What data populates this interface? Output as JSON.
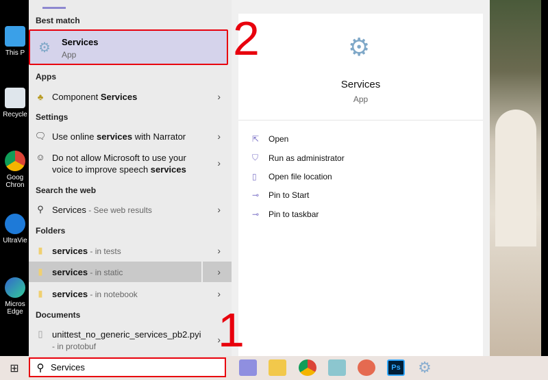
{
  "desktop": {
    "icons": [
      "This P",
      "Recycle",
      "Goog Chron",
      "UltraVie",
      "Micros Edge"
    ]
  },
  "left": {
    "best_match_header": "Best match",
    "best": {
      "title": "Services",
      "subtitle": "App"
    },
    "apps_header": "Apps",
    "apps": [
      {
        "pre": "Component ",
        "bold": "Services",
        "post": ""
      }
    ],
    "settings_header": "Settings",
    "settings": [
      {
        "pre": "Use online ",
        "bold": "services",
        "post": " with Narrator"
      },
      {
        "line1": "Do not allow Microsoft to use your",
        "line2pre": "voice to improve speech ",
        "line2bold": "services"
      }
    ],
    "web_header": "Search the web",
    "web": {
      "term": "Services",
      "suffix": " - See web results"
    },
    "folders_header": "Folders",
    "folders": [
      {
        "name": "services",
        "loc": " - in tests"
      },
      {
        "name": "services",
        "loc": " - in static"
      },
      {
        "name": "services",
        "loc": " - in notebook"
      }
    ],
    "documents_header": "Documents",
    "documents": [
      {
        "name": "unittest_no_generic_services_pb2.pyi",
        "loc": "- in protobuf"
      }
    ]
  },
  "preview": {
    "title": "Services",
    "subtitle": "App",
    "actions": [
      "Open",
      "Run as administrator",
      "Open file location",
      "Pin to Start",
      "Pin to taskbar"
    ]
  },
  "annotations": [
    "1",
    "2"
  ],
  "search": {
    "value": "Services"
  },
  "taskbar": {
    "apps": [
      "ultraviewer",
      "file-explorer",
      "chrome",
      "notepad",
      "snipping-tool",
      "photoshop",
      "services"
    ]
  },
  "colors": {
    "highlight": "#d5d3eb",
    "annotation": "#e8000d",
    "accent": "#7e74c8"
  }
}
